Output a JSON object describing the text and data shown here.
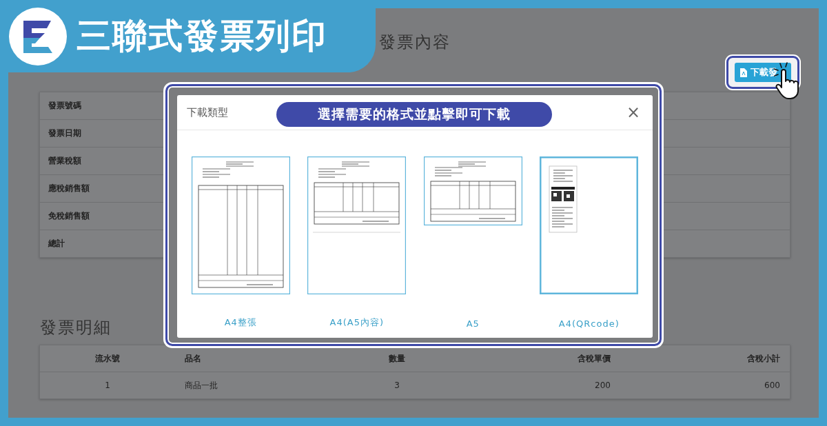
{
  "banner": {
    "title": "三聯式發票列印"
  },
  "page": {
    "title": "發票內容",
    "download_button": "下載發",
    "info_rows": [
      "發票號碼",
      "發票日期",
      "營業稅額",
      "應稅銷售額",
      "免稅銷售額",
      "總計"
    ],
    "details": {
      "title": "發票明細",
      "columns": [
        "流水號",
        "品名",
        "數量",
        "含稅單價",
        "含稅小計"
      ],
      "rows": [
        [
          "1",
          "商品一批",
          "3",
          "200",
          "600"
        ]
      ]
    }
  },
  "dialog": {
    "title": "下載類型",
    "close": "×",
    "hint": "選擇需要的格式並點擊即可下載",
    "formats": [
      {
        "label": "A4整張",
        "kind": "full",
        "selected": false
      },
      {
        "label": "A4(A5內容)",
        "kind": "half",
        "selected": false
      },
      {
        "label": "A5",
        "kind": "a5",
        "selected": false
      },
      {
        "label": "A4(QRcode)",
        "kind": "qr",
        "selected": true
      }
    ]
  }
}
